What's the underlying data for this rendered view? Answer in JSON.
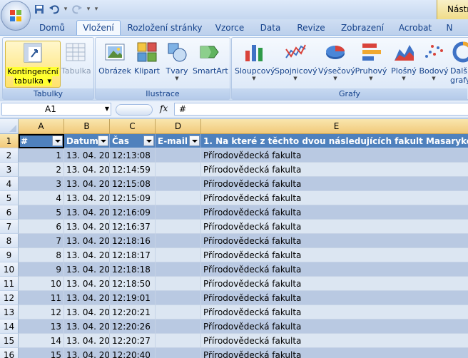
{
  "titlebar": {
    "tools_title": "Nástro",
    "qat": [
      "save-icon",
      "undo-icon",
      "redo-icon",
      "customize-icon"
    ]
  },
  "tabs": [
    "Domů",
    "Vložení",
    "Rozložení stránky",
    "Vzorce",
    "Data",
    "Revize",
    "Zobrazení",
    "Acrobat",
    "N"
  ],
  "active_tab": "Vložení",
  "ribbon": {
    "tabulky": {
      "label": "Tabulky",
      "pivot_line1": "Kontingenční",
      "pivot_line2": "tabulka",
      "table": "Tabulka"
    },
    "ilustrace": {
      "label": "Ilustrace",
      "picture": "Obrázek",
      "clipart": "Klipart",
      "shapes": "Tvary",
      "smartart": "SmartArt"
    },
    "grafy": {
      "label": "Grafy",
      "column": "Sloupcový",
      "line": "Spojnicový",
      "pie": "Výsečový",
      "bar": "Pruhový",
      "area": "Plošný",
      "scatter": "Bodový",
      "other1": "Dalš",
      "other2": "grafy"
    }
  },
  "formula": {
    "cell_ref": "A1",
    "fx": "fx",
    "content": "#"
  },
  "columns": [
    "A",
    "B",
    "C",
    "D",
    "E"
  ],
  "header_row": {
    "row": "1",
    "a": "#",
    "b": "Datum",
    "c": "Čas",
    "d": "E-mail",
    "e": "1. Na které z těchto dvou následujících fakult Masarykovy un"
  },
  "rows": [
    {
      "row": "2",
      "a": "1",
      "b": "13. 04. 201",
      "c": "12:13:08",
      "d": "",
      "e": "Přírodovědecká fakulta"
    },
    {
      "row": "3",
      "a": "2",
      "b": "13. 04. 201",
      "c": "12:14:59",
      "d": "",
      "e": "Přírodovědecká fakulta"
    },
    {
      "row": "4",
      "a": "3",
      "b": "13. 04. 201",
      "c": "12:15:08",
      "d": "",
      "e": "Přírodovědecká fakulta"
    },
    {
      "row": "5",
      "a": "4",
      "b": "13. 04. 201",
      "c": "12:15:09",
      "d": "",
      "e": "Přírodovědecká fakulta"
    },
    {
      "row": "6",
      "a": "5",
      "b": "13. 04. 201",
      "c": "12:16:09",
      "d": "",
      "e": "Přírodovědecká fakulta"
    },
    {
      "row": "7",
      "a": "6",
      "b": "13. 04. 201",
      "c": "12:16:37",
      "d": "",
      "e": "Přírodovědecká fakulta"
    },
    {
      "row": "8",
      "a": "7",
      "b": "13. 04. 201",
      "c": "12:18:16",
      "d": "",
      "e": "Přírodovědecká fakulta"
    },
    {
      "row": "9",
      "a": "8",
      "b": "13. 04. 201",
      "c": "12:18:17",
      "d": "",
      "e": "Přírodovědecká fakulta"
    },
    {
      "row": "10",
      "a": "9",
      "b": "13. 04. 201",
      "c": "12:18:18",
      "d": "",
      "e": "Přírodovědecká fakulta"
    },
    {
      "row": "11",
      "a": "10",
      "b": "13. 04. 201",
      "c": "12:18:50",
      "d": "",
      "e": "Přírodovědecká fakulta"
    },
    {
      "row": "12",
      "a": "11",
      "b": "13. 04. 201",
      "c": "12:19:01",
      "d": "",
      "e": "Přírodovědecká fakulta"
    },
    {
      "row": "13",
      "a": "12",
      "b": "13. 04. 201",
      "c": "12:20:21",
      "d": "",
      "e": "Přírodovědecká fakulta"
    },
    {
      "row": "14",
      "a": "13",
      "b": "13. 04. 201",
      "c": "12:20:26",
      "d": "",
      "e": "Přírodovědecká fakulta"
    },
    {
      "row": "15",
      "a": "14",
      "b": "13. 04. 201",
      "c": "12:20:27",
      "d": "",
      "e": "Přírodovědecká fakulta"
    },
    {
      "row": "16",
      "a": "15",
      "b": "13. 04. 201",
      "c": "12:20:40",
      "d": "",
      "e": "Přírodovědecká fakulta"
    }
  ],
  "colors": {
    "header_fill": "#4f81bd",
    "band_dark": "#b9c9e2",
    "band_light": "#dce6f2",
    "highlight": "#ffff30"
  }
}
